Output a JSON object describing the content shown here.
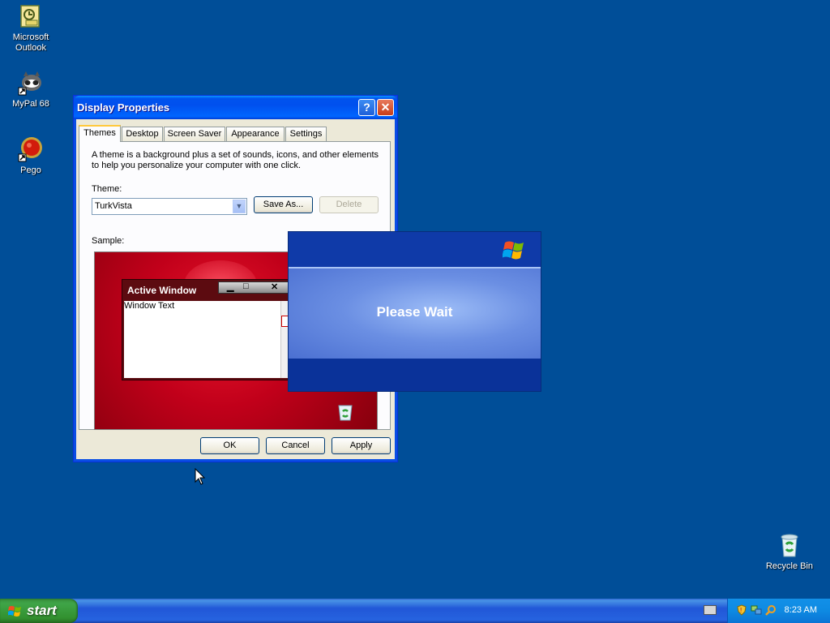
{
  "desktop": {
    "icons": [
      {
        "label": "Microsoft\nOutlook",
        "icon": "outlook-icon"
      },
      {
        "label": "MyPal 68",
        "icon": "mypal-icon"
      },
      {
        "label": "Pego",
        "icon": "pego-icon"
      },
      {
        "label": "Recycle Bin",
        "icon": "recycle-bin-icon"
      }
    ],
    "background_color": "#004e98"
  },
  "window": {
    "title": "Display Properties",
    "help_glyph": "?",
    "close_glyph": "✕",
    "tabs": [
      "Themes",
      "Desktop",
      "Screen Saver",
      "Appearance",
      "Settings"
    ],
    "active_tab": "Themes",
    "description": "A theme is a background plus a set of sounds, icons, and other elements to help you personalize your computer with one click.",
    "theme_label": "Theme:",
    "theme_value": "TurkVista",
    "save_as_label": "Save As...",
    "delete_label": "Delete",
    "sample_label": "Sample:",
    "sample": {
      "active_window_title": "Active Window",
      "window_text": "Window Text"
    },
    "ok_label": "OK",
    "cancel_label": "Cancel",
    "apply_label": "Apply"
  },
  "wait_dialog": {
    "message": "Please Wait"
  },
  "taskbar": {
    "start_label": "start",
    "clock": "8:23 AM"
  }
}
